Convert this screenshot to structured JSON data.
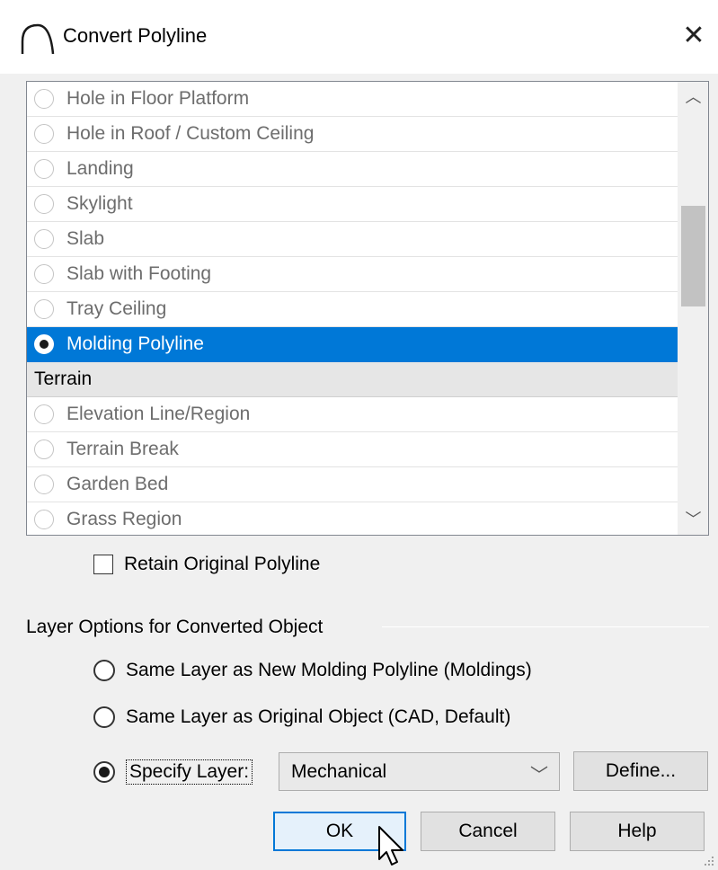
{
  "window": {
    "title": "Convert Polyline",
    "app_icon": "arch-icon",
    "close_glyph": "✕"
  },
  "list": {
    "rows": [
      {
        "label": "Hole in Floor Platform",
        "kind": "option"
      },
      {
        "label": "Hole in Roof / Custom Ceiling",
        "kind": "option"
      },
      {
        "label": "Landing",
        "kind": "option"
      },
      {
        "label": "Skylight",
        "kind": "option"
      },
      {
        "label": "Slab",
        "kind": "option"
      },
      {
        "label": "Slab with Footing",
        "kind": "option"
      },
      {
        "label": "Tray Ceiling",
        "kind": "option"
      },
      {
        "label": "Molding Polyline",
        "kind": "option",
        "selected": true
      },
      {
        "label": "Terrain",
        "kind": "header"
      },
      {
        "label": "Elevation Line/Region",
        "kind": "option"
      },
      {
        "label": "Terrain Break",
        "kind": "option"
      },
      {
        "label": "Garden Bed",
        "kind": "option"
      },
      {
        "label": "Grass Region",
        "kind": "option"
      }
    ],
    "scroll_up_glyph": "︿",
    "scroll_down_glyph": "﹀"
  },
  "retain": {
    "label": "Retain Original Polyline",
    "checked": false
  },
  "layer_options": {
    "group_label": "Layer Options for Converted Object",
    "opt1": {
      "label": "Same Layer as New Molding Polyline (Moldings)",
      "checked": false
    },
    "opt2": {
      "label": "Same Layer as Original Object (CAD,  Default)",
      "checked": false
    },
    "opt3": {
      "label": "Specify Layer:",
      "checked": true
    },
    "layer_select": {
      "value": "Mechanical",
      "chevron": "﹀"
    },
    "define_label": "Define..."
  },
  "buttons": {
    "ok": "OK",
    "cancel": "Cancel",
    "help": "Help"
  },
  "colors": {
    "selection": "#0078d7",
    "default_button_border": "#0078d7"
  }
}
